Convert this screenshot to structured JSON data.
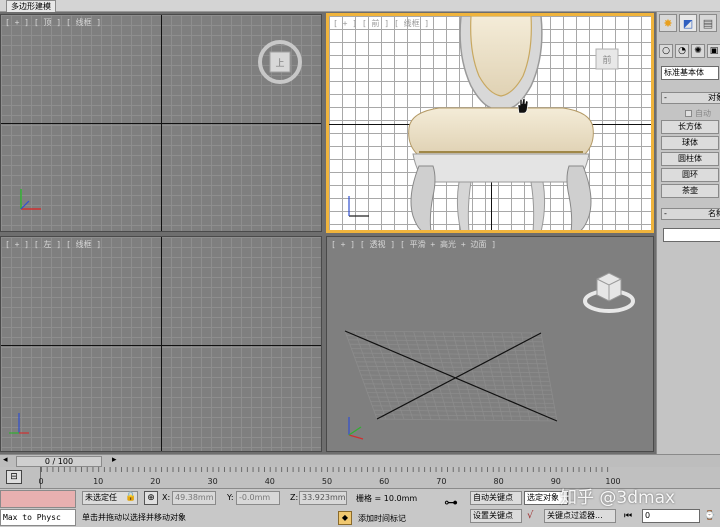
{
  "app": {
    "ribbon_tab": "多边形建模"
  },
  "viewports": {
    "top_left": {
      "label": "[ + ] [ 顶 ] [ 线框 ]",
      "gizmo_text": "上"
    },
    "top_right": {
      "label": "[ + ] [ 前 ] [ 线框 ]",
      "gizmo_text": "前"
    },
    "bottom_left": {
      "label": "[ + ] [ 左 ] [ 线框 ]"
    },
    "bottom_right": {
      "label": "[ + ] [ 透视 ] [ 平滑 + 高光 + 边面 ]"
    }
  },
  "command_panel": {
    "dropdown": "标准基本体",
    "object_type_title": "对象",
    "autogrid": "自动",
    "buttons": [
      "长方体",
      "球体",
      "圆柱体",
      "圆环",
      "茶壶"
    ],
    "name_color_title": "名称",
    "minus": "-"
  },
  "timeline": {
    "frame_counter": "0 / 100",
    "ticks": [
      "0",
      "10",
      "20",
      "30",
      "40",
      "50",
      "60",
      "70",
      "80",
      "90",
      "100"
    ]
  },
  "status": {
    "maxscript": "Max to Physc",
    "selection": "未选定任",
    "x_label": "X:",
    "x_value": "49.38mm",
    "y_label": "Y:",
    "y_value": "-0.0mm",
    "z_label": "Z:",
    "z_value": "33.923mm",
    "grid": "栅格 = 10.0mm",
    "prompt": "单击并拖动以选择并移动对象",
    "add_time_tag": "添加时间标记",
    "auto_key": "自动关键点",
    "set_key": "设置关键点",
    "selected_dropdown": "选定对象",
    "key_filters": "关键点过滤器...",
    "frame_field": "0"
  },
  "watermark": "知乎 @3dmax",
  "colors": {
    "active_viewport_border": "#f0b43c",
    "maxscript_listener": "#e8b0b0"
  }
}
